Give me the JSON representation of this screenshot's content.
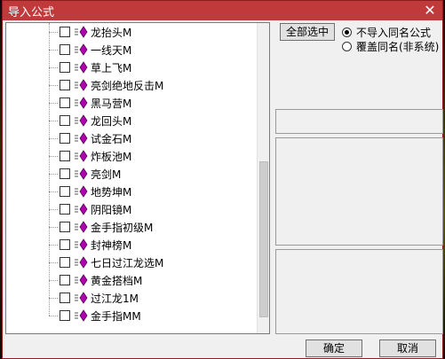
{
  "window": {
    "title": "导入公式",
    "close_glyph": "✕"
  },
  "tree": {
    "items": [
      {
        "label": "龙抬头M",
        "checked": false
      },
      {
        "label": "一线天M",
        "checked": false
      },
      {
        "label": "草上飞M",
        "checked": false
      },
      {
        "label": "亮剑绝地反击M",
        "checked": false
      },
      {
        "label": "黑马营M",
        "checked": false
      },
      {
        "label": "龙回头M",
        "checked": false
      },
      {
        "label": "试金石M",
        "checked": false
      },
      {
        "label": "炸板池M",
        "checked": false
      },
      {
        "label": "亮剑M",
        "checked": false
      },
      {
        "label": "地势坤M",
        "checked": false
      },
      {
        "label": "阴阳镜M",
        "checked": false
      },
      {
        "label": "金手指初级M",
        "checked": false
      },
      {
        "label": "封神榜M",
        "checked": false
      },
      {
        "label": "七日过江龙选M",
        "checked": false
      },
      {
        "label": "黄金搭档M",
        "checked": false
      },
      {
        "label": "过江龙1M",
        "checked": false
      },
      {
        "label": "金手指MM",
        "checked": false
      }
    ],
    "icon": "formula-node-icon",
    "icon_color": "#b000b0"
  },
  "controls": {
    "select_all_label": "全部选中",
    "options": [
      {
        "label": "不导入同名公式",
        "selected": true
      },
      {
        "label": "覆盖同名(非系统)",
        "selected": false
      }
    ],
    "ok_label": "确定",
    "cancel_label": "取消"
  },
  "colors": {
    "titlebar": "#c0393b",
    "accent_icon": "#b000b0"
  }
}
